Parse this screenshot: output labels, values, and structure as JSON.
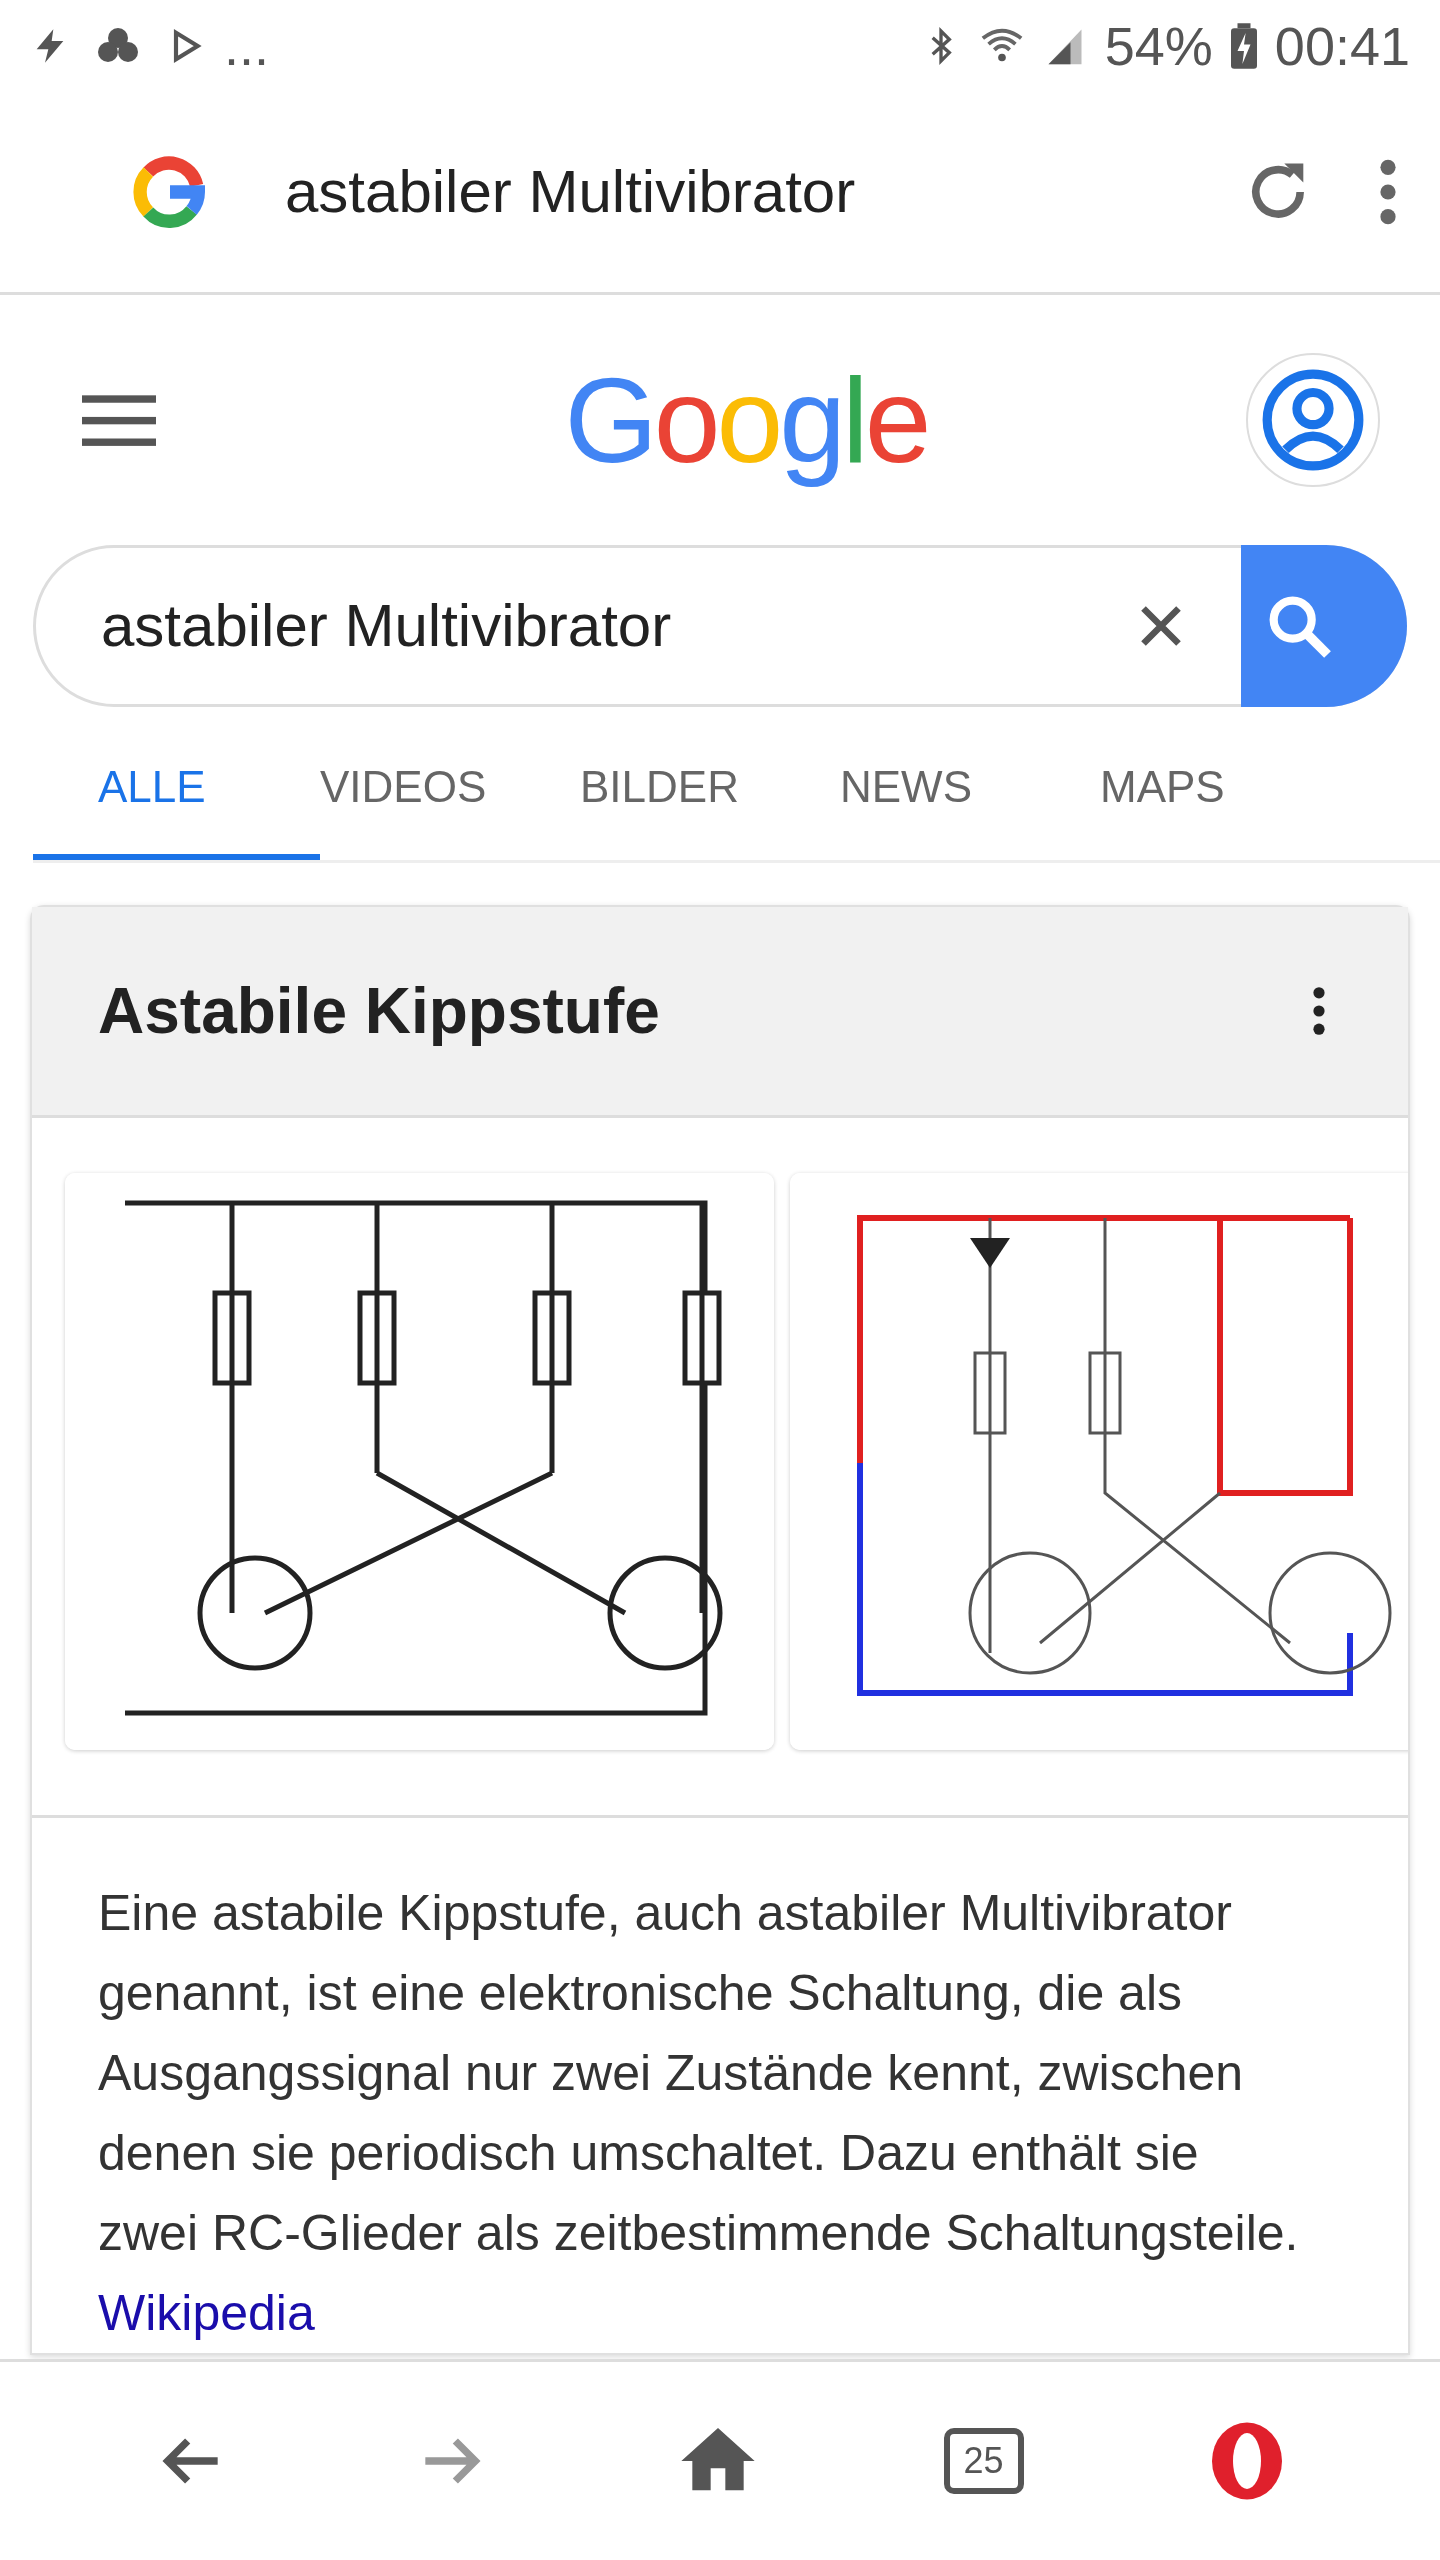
{
  "status_bar": {
    "more_notifications": "...",
    "battery": "54%",
    "time": "00:41"
  },
  "url_bar": {
    "query": "astabiler Multivibrator"
  },
  "header": {
    "logo": "Google"
  },
  "search": {
    "value": "astabiler Multivibrator"
  },
  "tabs": [
    {
      "label": "ALLE",
      "selected": true
    },
    {
      "label": "VIDEOS",
      "selected": false
    },
    {
      "label": "BILDER",
      "selected": false
    },
    {
      "label": "NEWS",
      "selected": false
    },
    {
      "label": "MAPS",
      "selected": false
    }
  ],
  "card": {
    "title": "Astabile Kippstufe",
    "description": "Eine astabile Kippstufe, auch astabiler Multivibrator genannt, ist eine elektronische Schaltung, die als Ausgangssignal nur zwei Zustände kennt, zwischen denen sie periodisch umschaltet. Dazu enthält sie zwei RC-Glieder als zeitbestimmende Schaltungsteile.",
    "source_link": "Wikipedia"
  },
  "bottom_nav": {
    "tab_count": "25"
  }
}
